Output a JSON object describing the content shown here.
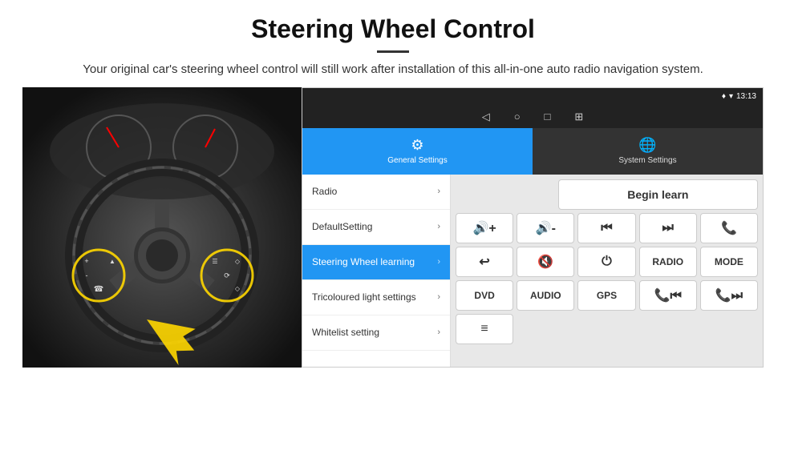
{
  "header": {
    "title": "Steering Wheel Control",
    "subtitle": "Your original car's steering wheel control will still work after installation of this all-in-one auto radio navigation system."
  },
  "statusbar": {
    "time": "13:13"
  },
  "navbar": {
    "back": "◁",
    "home": "○",
    "square": "□",
    "grid": "⊞"
  },
  "tabs": [
    {
      "id": "general",
      "icon": "⚙",
      "label": "General Settings",
      "active": true
    },
    {
      "id": "system",
      "icon": "🌐",
      "label": "System Settings",
      "active": false
    }
  ],
  "menu": [
    {
      "id": "radio",
      "label": "Radio",
      "active": false
    },
    {
      "id": "default",
      "label": "DefaultSetting",
      "active": false
    },
    {
      "id": "steering",
      "label": "Steering Wheel learning",
      "active": true
    },
    {
      "id": "tricoloured",
      "label": "Tricoloured light settings",
      "active": false
    },
    {
      "id": "whitelist",
      "label": "Whitelist setting",
      "active": false
    }
  ],
  "buttons": {
    "begin_learn": "Begin learn",
    "row1": [
      "🔊+",
      "🔊-",
      "⏮",
      "⏭",
      "📞"
    ],
    "row2": [
      "↩",
      "🔊x",
      "⏻",
      "RADIO",
      "MODE"
    ],
    "row3": [
      "DVD",
      "AUDIO",
      "GPS",
      "📞⏮",
      "📞⏭"
    ],
    "row4_icon": "≡"
  }
}
